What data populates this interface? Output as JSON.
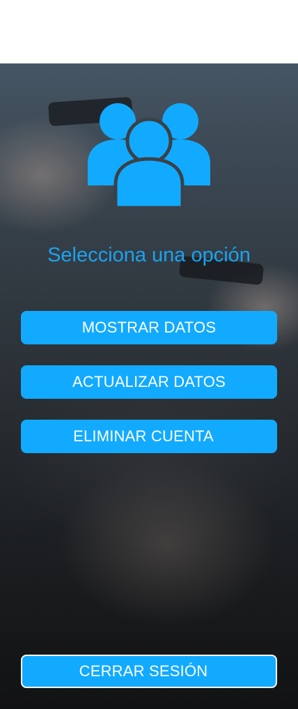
{
  "title": "Selecciona una opción",
  "icon": "users-group-icon",
  "colors": {
    "accent": "#12aaff",
    "title_text": "#1aa3f0",
    "button_text": "#ffffff"
  },
  "buttons": {
    "show_data": "MOSTRAR DATOS",
    "update_data": "ACTUALIZAR DATOS",
    "delete_account": "ELIMINAR CUENTA",
    "logout": "CERRAR SESIÓN"
  }
}
